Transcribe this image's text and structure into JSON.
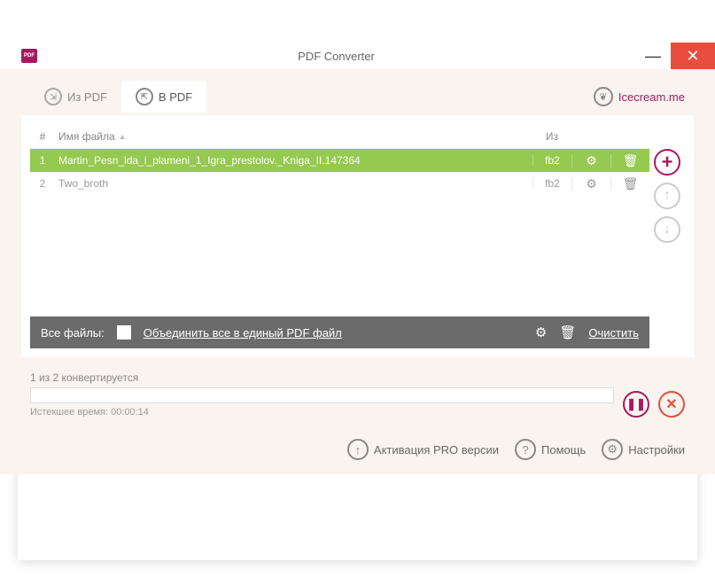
{
  "title": "PDF Converter",
  "tabs": {
    "from_pdf": "Из PDF",
    "to_pdf": "В PDF"
  },
  "brand_link": "Icecream.me",
  "table": {
    "headers": {
      "num": "#",
      "name": "Имя файла",
      "from": "Из"
    },
    "rows": [
      {
        "n": "1",
        "name": "Martin_Pesn_lda_i_plameni_1_Igra_prestolov._Kniga_II.147364",
        "from": "fb2"
      },
      {
        "n": "2",
        "name": "Two_broth",
        "from": "fb2"
      }
    ]
  },
  "footer_bar": {
    "all_files": "Все файлы:",
    "merge": "Объединить все в единый PDF файл",
    "clear": "Очистить"
  },
  "progress": {
    "status": "1 из 2 конвертируется",
    "elapsed_label": "Истекшее время:",
    "elapsed_time": "00:00:14"
  },
  "bottom": {
    "pro": "Активация PRO версии",
    "help": "Помощь",
    "settings": "Настройки"
  }
}
